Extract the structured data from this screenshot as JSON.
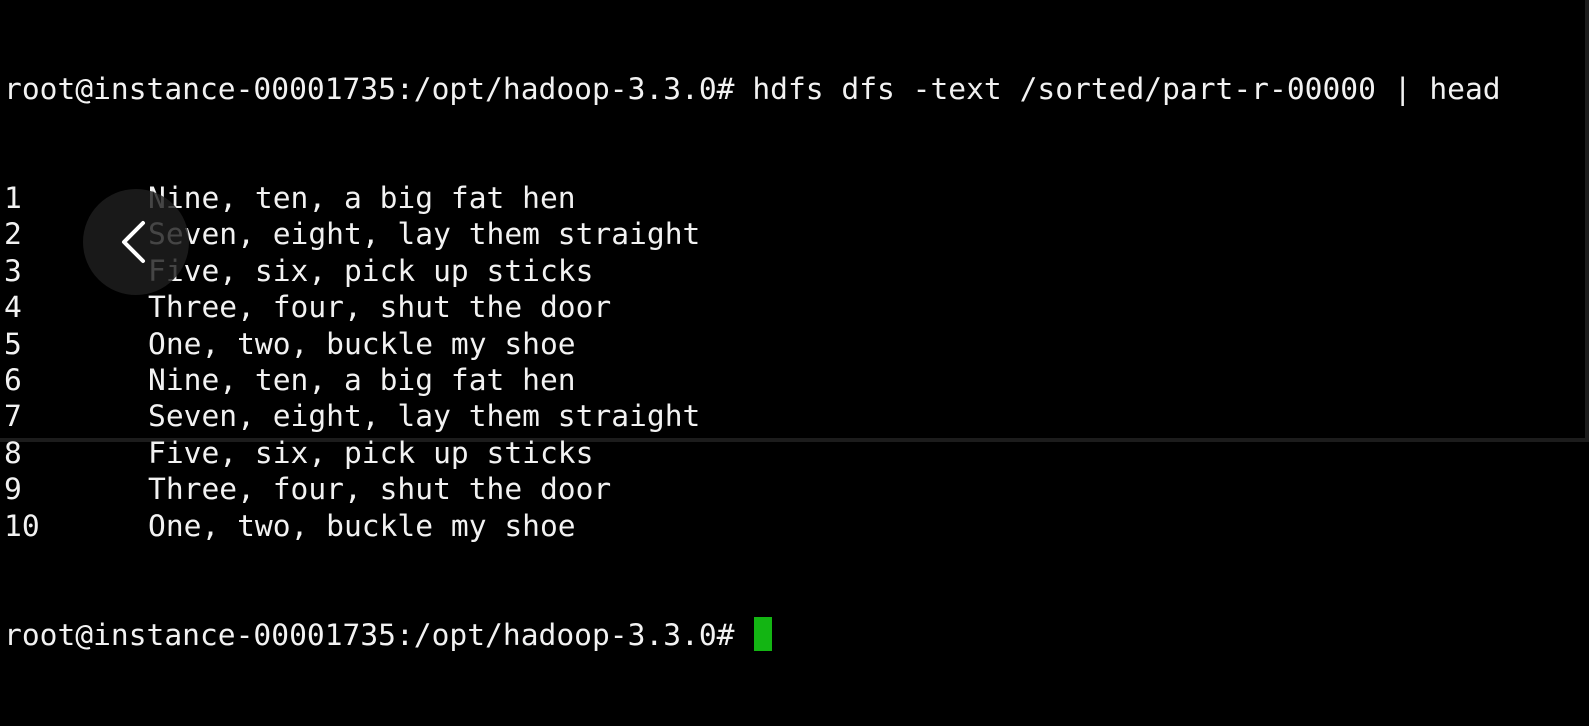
{
  "terminal": {
    "command_prompt": "root@instance-00001735:/opt/hadoop-3.3.0# ",
    "command": "hdfs dfs -text /sorted/part-r-00000 | head",
    "rows": [
      {
        "num": "1",
        "text": "Nine, ten, a big fat hen"
      },
      {
        "num": "2",
        "text": "Seven, eight, lay them straight"
      },
      {
        "num": "3",
        "text": "Five, six, pick up sticks"
      },
      {
        "num": "4",
        "text": "Three, four, shut the door"
      },
      {
        "num": "5",
        "text": "One, two, buckle my shoe"
      },
      {
        "num": "6",
        "text": "Nine, ten, a big fat hen"
      },
      {
        "num": "7",
        "text": "Seven, eight, lay them straight"
      },
      {
        "num": "8",
        "text": "Five, six, pick up sticks"
      },
      {
        "num": "9",
        "text": "Three, four, shut the door"
      },
      {
        "num": "10",
        "text": "One, two, buckle my shoe"
      }
    ],
    "final_prompt": "root@instance-00001735:/opt/hadoop-3.3.0# "
  },
  "overlay": {
    "back_icon": "chevron-left-icon"
  },
  "colors": {
    "background": "#000000",
    "text": "#f2f2f2",
    "cursor": "#13b513",
    "overlay_button": "#1e1e1e",
    "overlay_icon": "#ffffff"
  }
}
